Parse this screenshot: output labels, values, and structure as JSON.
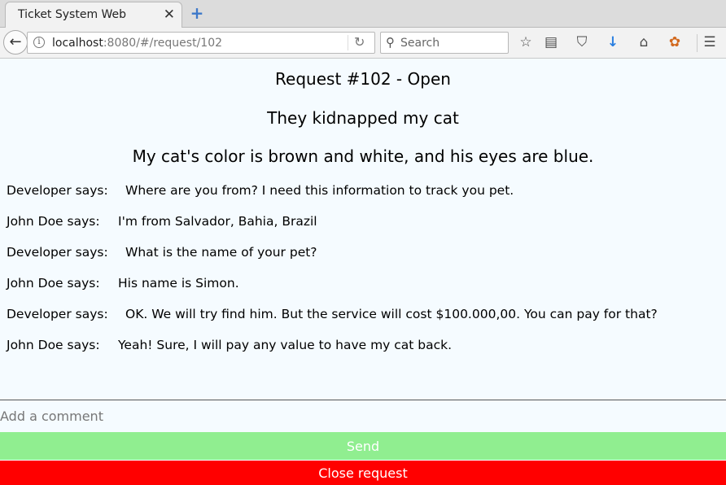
{
  "browser": {
    "tab_title": "Ticket System Web",
    "url_host": "localhost",
    "url_rest": ":8080/#/request/102",
    "search_placeholder": "Search"
  },
  "request": {
    "title": "Request #102 - Open",
    "subject": "They kidnapped my cat",
    "description": "My cat's color is brown and white, and his eyes are blue."
  },
  "comments": [
    {
      "author": "Developer says:",
      "text": "Where are you from? I need this information to track you pet."
    },
    {
      "author": "John Doe says:",
      "text": "I'm from Salvador, Bahia, Brazil"
    },
    {
      "author": "Developer says:",
      "text": "What is the name of your pet?"
    },
    {
      "author": "John Doe says:",
      "text": "His name is Simon."
    },
    {
      "author": "Developer says:",
      "text": "OK. We will try find him. But the service will cost $100.000,00. You can pay for that?"
    },
    {
      "author": "John Doe says:",
      "text": "Yeah! Sure, I will pay any value to have my cat back."
    }
  ],
  "form": {
    "comment_placeholder": "Add a comment",
    "send_label": "Send",
    "close_label": "Close request"
  },
  "colors": {
    "send": "#90ee90",
    "close": "#ff0000",
    "page_background": "#f5fbff"
  }
}
